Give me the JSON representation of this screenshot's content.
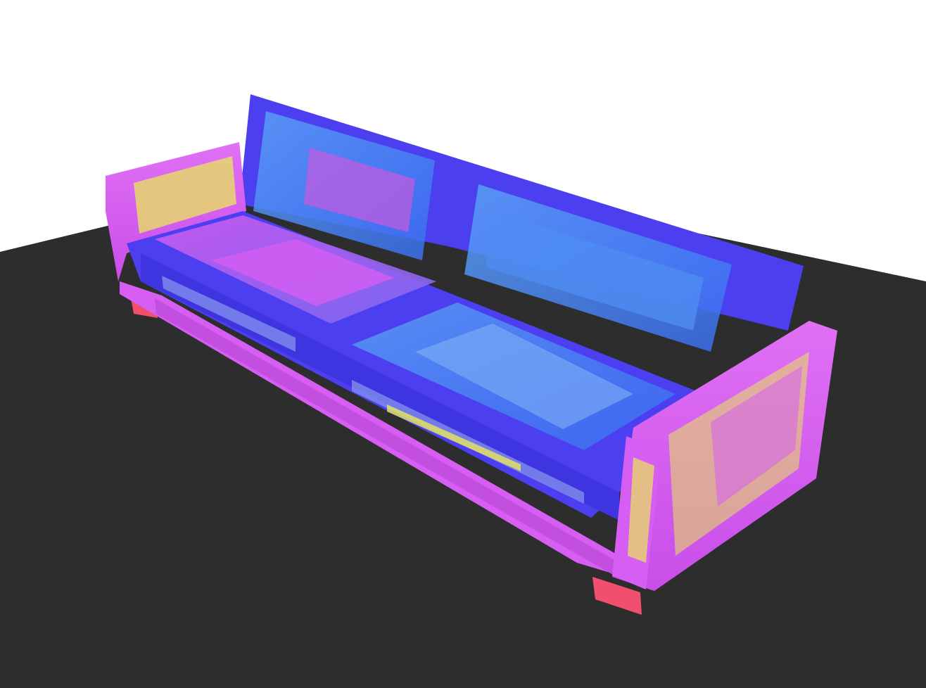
{
  "scene": {
    "object": "sofa",
    "view": "3d-part-segmentation-render",
    "colors": {
      "background": "#ffffff",
      "floor": "#2d2d2d",
      "back_and_seat_frame": "#4b3ff0",
      "cushion_glass": "#3f7df0",
      "arms_and_base": "#d65ef2",
      "arm_detail": "#e8e85a",
      "legs": "#f0506e"
    },
    "parts": [
      "backrest",
      "seat-frame",
      "seat-cushion-left",
      "seat-cushion-right",
      "back-cushion-left",
      "back-cushion-right",
      "left-arm",
      "right-arm",
      "base",
      "leg-front-right",
      "leg-back-left"
    ]
  }
}
